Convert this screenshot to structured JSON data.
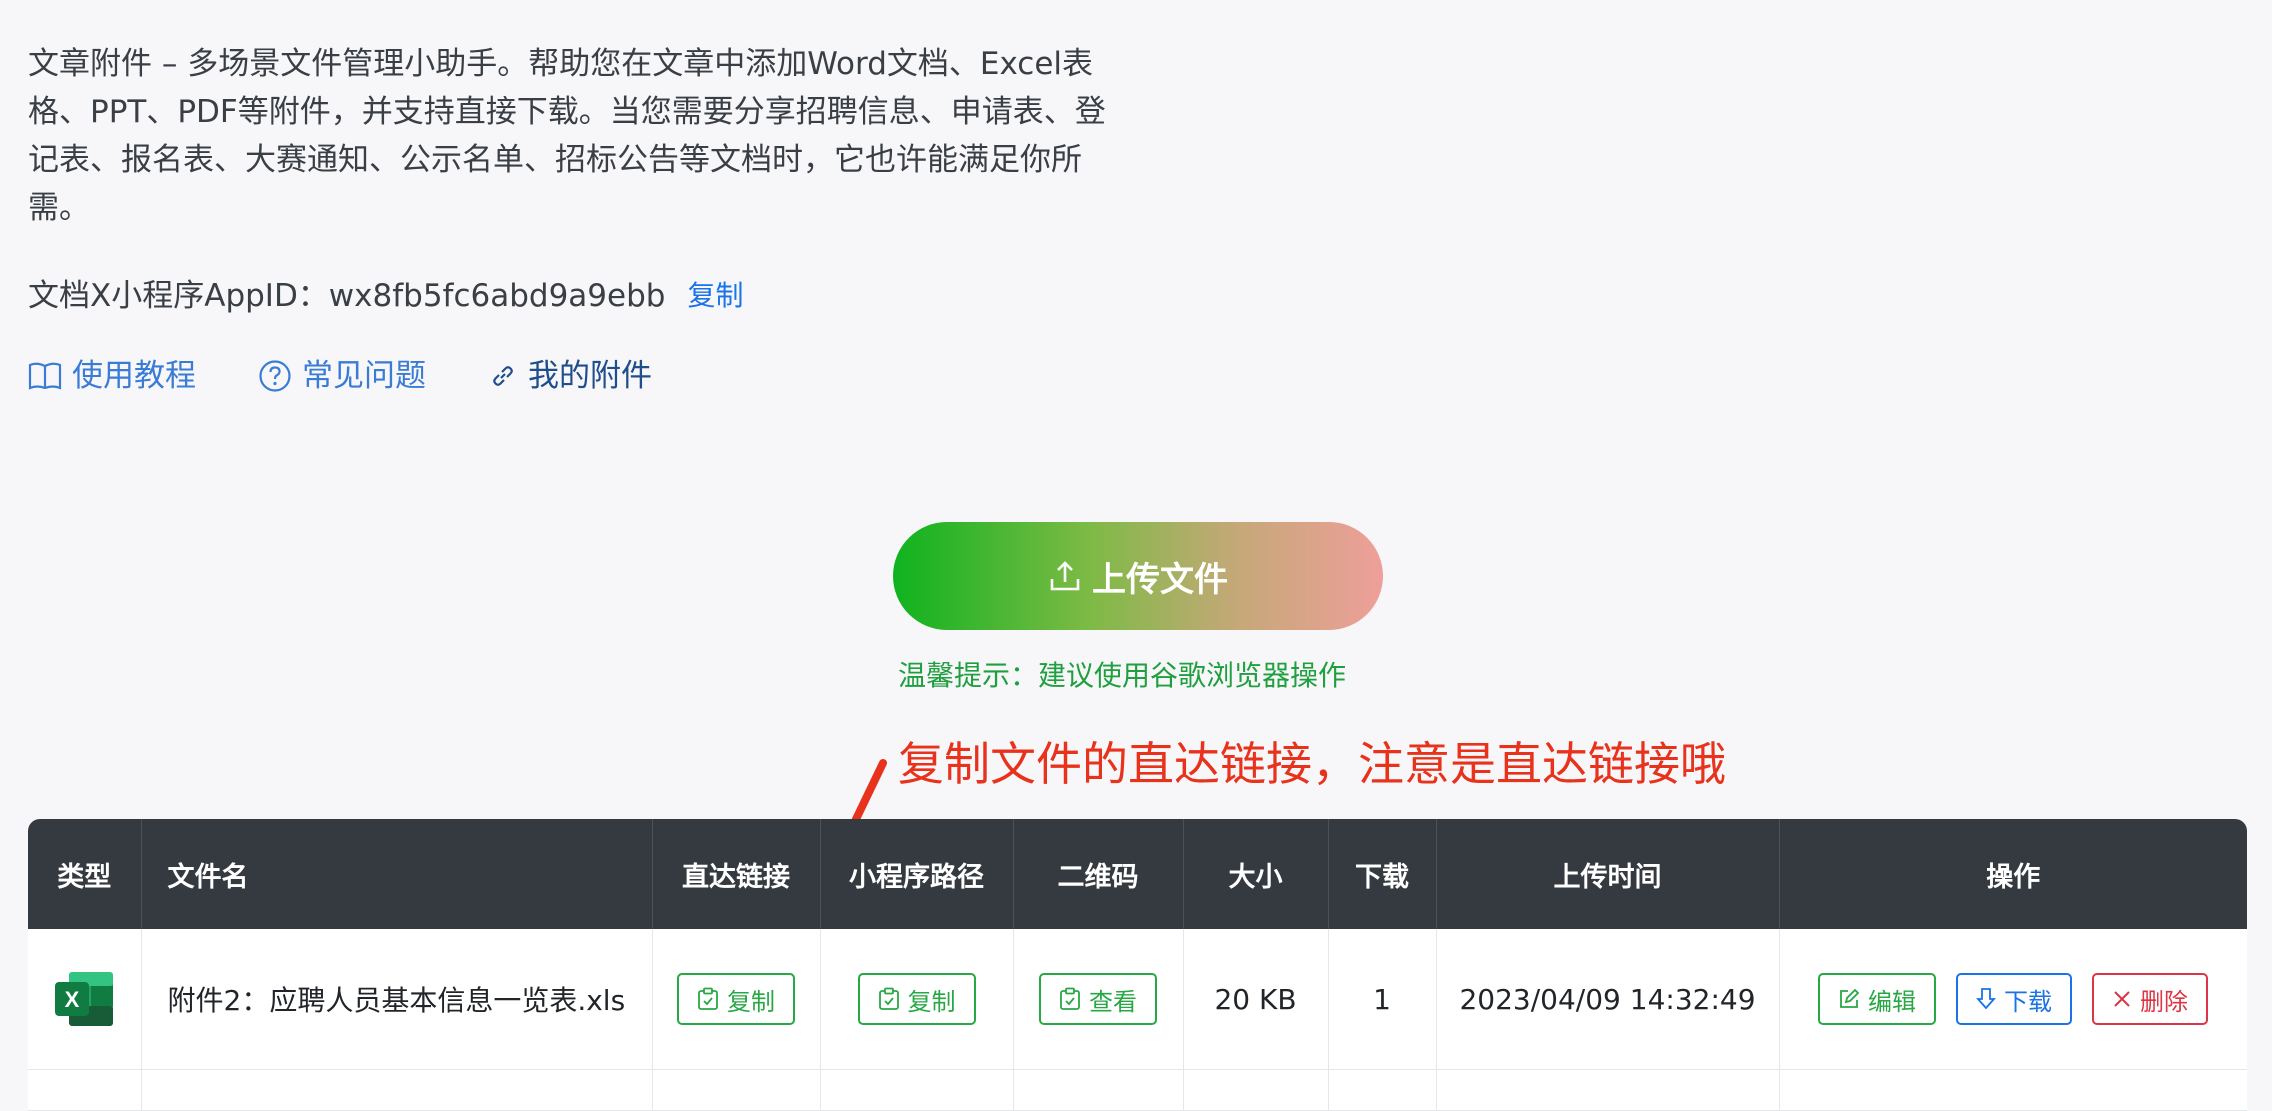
{
  "intro": {
    "text": "文章附件 – 多场景文件管理小助手。帮助您在文章中添加Word文档、Excel表格、PPT、PDF等附件，并支持直接下载。当您需要分享招聘信息、申请表、登记表、报名表、大赛通知、公示名单、招标公告等文档时，它也许能满足你所需。"
  },
  "appid": {
    "label": "文档X小程序AppID：wx8fb5fc6abd9a9ebb",
    "copy_label": "复制"
  },
  "links": {
    "tutorial": "使用教程",
    "faq": "常见问题",
    "my_attachments": "我的附件"
  },
  "upload": {
    "label": "上传文件"
  },
  "tip": "温馨提示：建议使用谷歌浏览器操作",
  "annotation": "复制文件的直达链接，注意是直达链接哦",
  "table": {
    "headers": {
      "type": "类型",
      "filename": "文件名",
      "direct_link": "直达链接",
      "mini_path": "小程序路径",
      "qrcode": "二维码",
      "size": "大小",
      "downloads": "下载",
      "upload_time": "上传时间",
      "actions": "操作"
    },
    "rows": [
      {
        "icon": "excel-icon",
        "filename": "附件2：应聘人员基本信息一览表.xls",
        "direct_link_btn": "复制",
        "mini_path_btn": "复制",
        "qrcode_btn": "查看",
        "size": "20 KB",
        "downloads": "1",
        "upload_time": "2023/04/09 14:32:49",
        "edit": "编辑",
        "download": "下载",
        "delete": "删除"
      }
    ]
  },
  "colors": {
    "accent_green": "#28a745",
    "accent_blue": "#1a73e8",
    "danger_red": "#dc3545",
    "annotation_red": "#e8321c",
    "header_dark": "#343a40"
  }
}
